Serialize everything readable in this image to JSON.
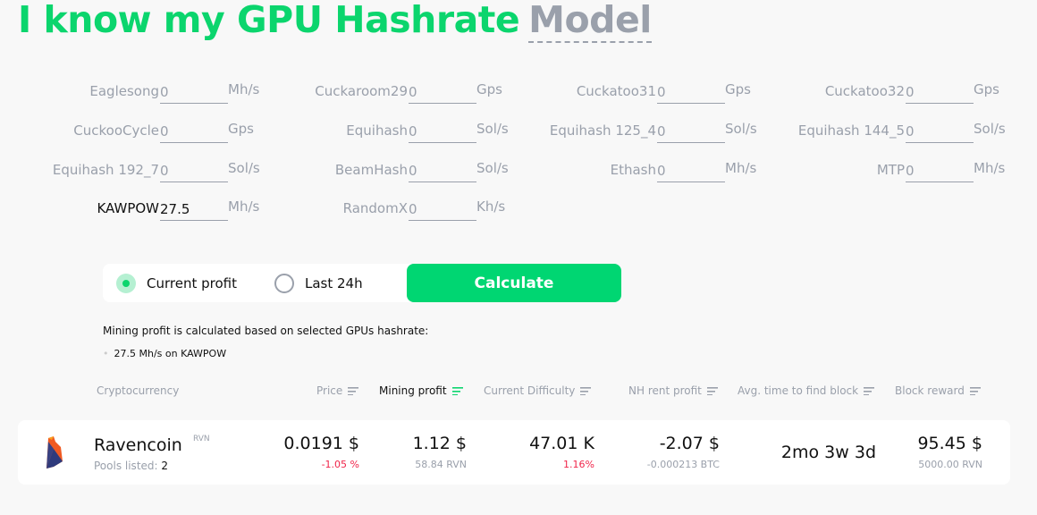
{
  "header": {
    "title": "I know my GPU Hashrate",
    "mode_link": "Model"
  },
  "algorithms": [
    {
      "name": "Eaglesong",
      "value": "0",
      "unit": "Mh/s"
    },
    {
      "name": "Cuckaroom29",
      "value": "0",
      "unit": "Gps"
    },
    {
      "name": "Cuckatoo31",
      "value": "0",
      "unit": "Gps"
    },
    {
      "name": "Cuckatoo32",
      "value": "0",
      "unit": "Gps"
    },
    {
      "name": "CuckooCycle",
      "value": "0",
      "unit": "Gps"
    },
    {
      "name": "Equihash",
      "value": "0",
      "unit": "Sol/s"
    },
    {
      "name": "Equihash 125_4",
      "value": "0",
      "unit": "Sol/s"
    },
    {
      "name": "Equihash 144_5",
      "value": "0",
      "unit": "Sol/s"
    },
    {
      "name": "Equihash 192_7",
      "value": "0",
      "unit": "Sol/s"
    },
    {
      "name": "BeamHash",
      "value": "0",
      "unit": "Sol/s"
    },
    {
      "name": "Ethash",
      "value": "0",
      "unit": "Mh/s"
    },
    {
      "name": "MTP",
      "value": "0",
      "unit": "Mh/s"
    },
    {
      "name": "KAWPOW",
      "value": "27.5",
      "unit": "Mh/s"
    },
    {
      "name": "RandomX",
      "value": "0",
      "unit": "Kh/s"
    }
  ],
  "controls": {
    "current_profit": "Current profit",
    "last_24h": "Last 24h",
    "selected": "current_profit",
    "calculate": "Calculate"
  },
  "summary": {
    "note": "Mining profit is calculated based on selected GPUs hashrate:",
    "items": [
      "27.5 Mh/s on KAWPOW"
    ]
  },
  "table": {
    "headers": [
      "Cryptocurrency",
      "Price",
      "Mining profit",
      "Current Difficulty",
      "NH rent profit",
      "Avg. time to find block",
      "Block reward"
    ],
    "active_sort": "Mining profit",
    "rows": [
      {
        "name": "Ravencoin",
        "symbol": "RVN",
        "pools_label": "Pools listed:",
        "pools": "2",
        "price": "0.0191 $",
        "price_change": "-1.05 %",
        "profit": "1.12 $",
        "profit_coin": "58.84 RVN",
        "difficulty": "47.01 K",
        "difficulty_change": "1.16%",
        "nh_profit": "-2.07 $",
        "nh_profit_btc": "-0.000213 BTC",
        "block_time": "2mo 3w 3d",
        "reward": "95.45 $",
        "reward_coin": "5000.00 RVN"
      }
    ]
  },
  "colors": {
    "accent": "#0bd56d",
    "button": "#00d672",
    "negative": "#f0254a",
    "muted": "#9aa0ab"
  }
}
